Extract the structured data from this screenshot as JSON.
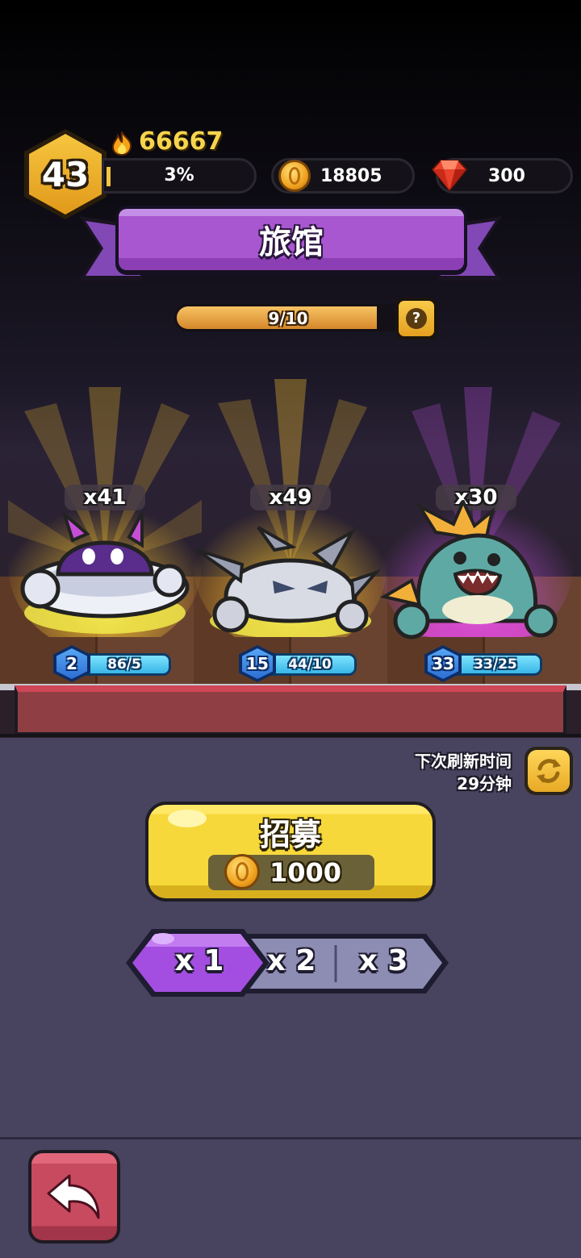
{
  "hud": {
    "level": "43",
    "power": "66667",
    "xp_percent_label": "3%",
    "xp_fraction": 0.03,
    "gold": "18805",
    "gems": "300"
  },
  "header": {
    "title": "旅馆"
  },
  "capacity": {
    "label": "9/10",
    "fraction": 0.9,
    "help_glyph": "?"
  },
  "heroes": [
    {
      "name_icon": "purple-ufo-creature",
      "count": "x41",
      "level": "2",
      "progress": "86/5",
      "glow": "#f8d84a"
    },
    {
      "name_icon": "spiky-silver-creature",
      "count": "x49",
      "level": "15",
      "progress": "44/10",
      "glow": "#f8d84a"
    },
    {
      "name_icon": "teal-dino-creature",
      "count": "x30",
      "level": "33",
      "progress": "33/25",
      "glow": "#d65cff"
    }
  ],
  "refresh": {
    "label": "下次刷新时间",
    "time": "29分钟"
  },
  "recruit": {
    "label": "招募",
    "cost": "1000"
  },
  "multiplier": {
    "options": [
      "x 1",
      "x 2",
      "x 3"
    ],
    "selected": "x 1"
  },
  "colors": {
    "accent_purple": "#a957d1",
    "gold": "#f7d83b",
    "back_button": "#c84a5f"
  }
}
